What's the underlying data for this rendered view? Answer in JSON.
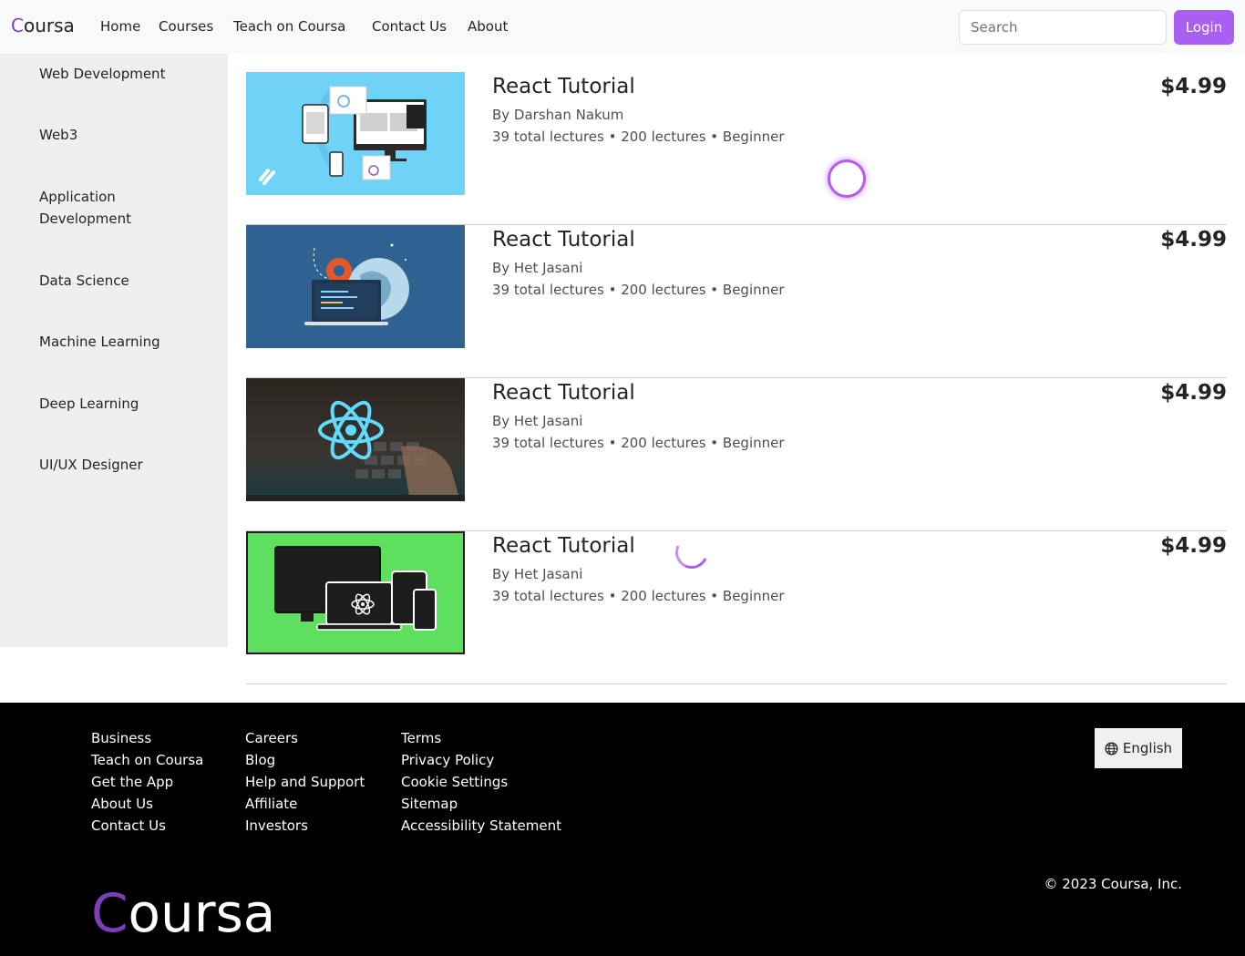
{
  "navbar": {
    "brand_first": "C",
    "brand_rest": "oursa",
    "links": [
      "Home",
      "Courses",
      "Teach on Coursa",
      "Contact Us",
      "About"
    ],
    "search_placeholder": "Search",
    "login_label": "Login"
  },
  "sidebar": {
    "categories": [
      "Web Development",
      "Web3",
      "Application Development",
      "Data Science",
      "Machine Learning",
      "Deep Learning",
      "UI/UX Designer"
    ]
  },
  "courses": [
    {
      "title": "React Tutorial",
      "author": "By Darshan Nakum",
      "meta": "39 total lectures • 200 lectures • Beginner",
      "price": "$4.99"
    },
    {
      "title": "React Tutorial",
      "author": "By Het Jasani",
      "meta": "39 total lectures • 200 lectures • Beginner",
      "price": "$4.99"
    },
    {
      "title": "React Tutorial",
      "author": "By Het Jasani",
      "meta": "39 total lectures • 200 lectures • Beginner",
      "price": "$4.99"
    },
    {
      "title": "React Tutorial",
      "author": "By Het Jasani",
      "meta": "39 total lectures • 200 lectures • Beginner",
      "price": "$4.99"
    }
  ],
  "footer": {
    "col1": [
      "Business",
      "Teach on Coursa",
      "Get the App",
      "About Us",
      "Contact Us"
    ],
    "col2": [
      "Careers",
      "Blog",
      "Help and Support",
      "Affiliate",
      "Investors"
    ],
    "col3": [
      "Terms",
      "Privacy Policy",
      "Cookie Settings",
      "Sitemap",
      "Accessibility Statement"
    ],
    "language_label": "English",
    "copyright": "© 2023 Coursa, Inc.",
    "logo_first": "C",
    "logo_rest": "oursa"
  },
  "colors": {
    "accent": "#a95ff0",
    "brand_c": "#7b3fb8",
    "footer_bg": "#000000",
    "sidebar_bg": "#efefef"
  },
  "icons": {
    "language": "globe-icon"
  }
}
